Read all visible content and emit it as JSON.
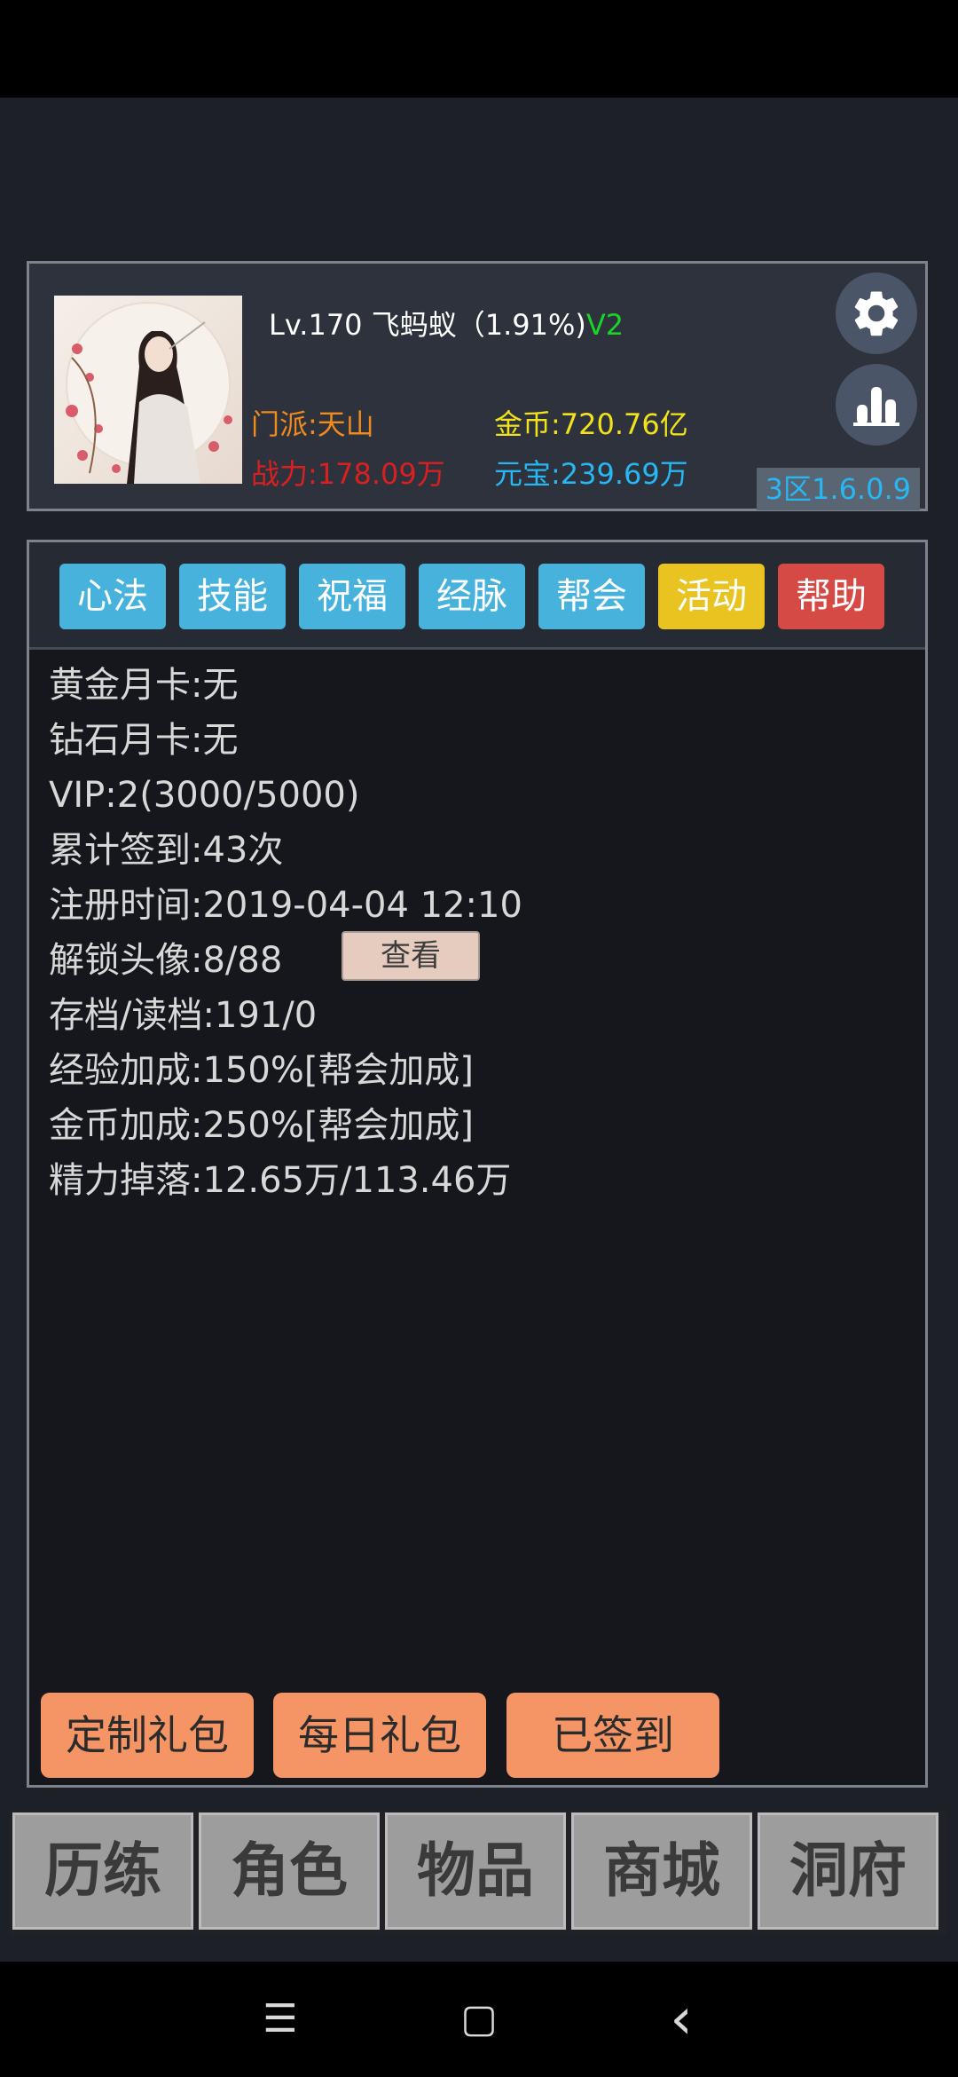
{
  "profile": {
    "level_name": "Lv.170 飞蚂蚁（1.91%)",
    "vip_tag": "V2",
    "sect": "门派:天山",
    "power": "战力:178.09万",
    "gold": "金币:720.76亿",
    "yuanbao": "元宝:239.69万",
    "server": "3区1.6.0.9",
    "icons": {
      "settings": "gear-icon",
      "stats": "bar-chart-icon"
    }
  },
  "tabs": [
    {
      "label": "心法",
      "color": "#47b2dc"
    },
    {
      "label": "技能",
      "color": "#47b2dc"
    },
    {
      "label": "祝福",
      "color": "#47b2dc"
    },
    {
      "label": "经脉",
      "color": "#47b2dc"
    },
    {
      "label": "帮会",
      "color": "#47b2dc"
    },
    {
      "label": "活动",
      "color": "#e9c31f"
    },
    {
      "label": "帮助",
      "color": "#d64a46"
    }
  ],
  "info": {
    "gold_card": "黄金月卡:无",
    "diamond_card": "钻石月卡:无",
    "vip": "VIP:2(3000/5000)",
    "checkin_total": "累计签到:43次",
    "register_time": "注册时间:2019-04-04 12:10",
    "avatars_unlocked": "解锁头像:8/88",
    "view_button": "查看",
    "save_load": "存档/读档:191/0",
    "exp_bonus": "经验加成:150%[帮会加成]",
    "gold_bonus": "金币加成:250%[帮会加成]",
    "energy_drop": "精力掉落:12.65万/113.46万"
  },
  "gifts": {
    "custom": "定制礼包",
    "daily": "每日礼包",
    "checked_in": "已签到"
  },
  "bottom_tabs": [
    "历练",
    "角色",
    "物品",
    "商城",
    "洞府"
  ],
  "system_nav": {
    "menu": "☰",
    "home": "▢",
    "back": "‹"
  }
}
